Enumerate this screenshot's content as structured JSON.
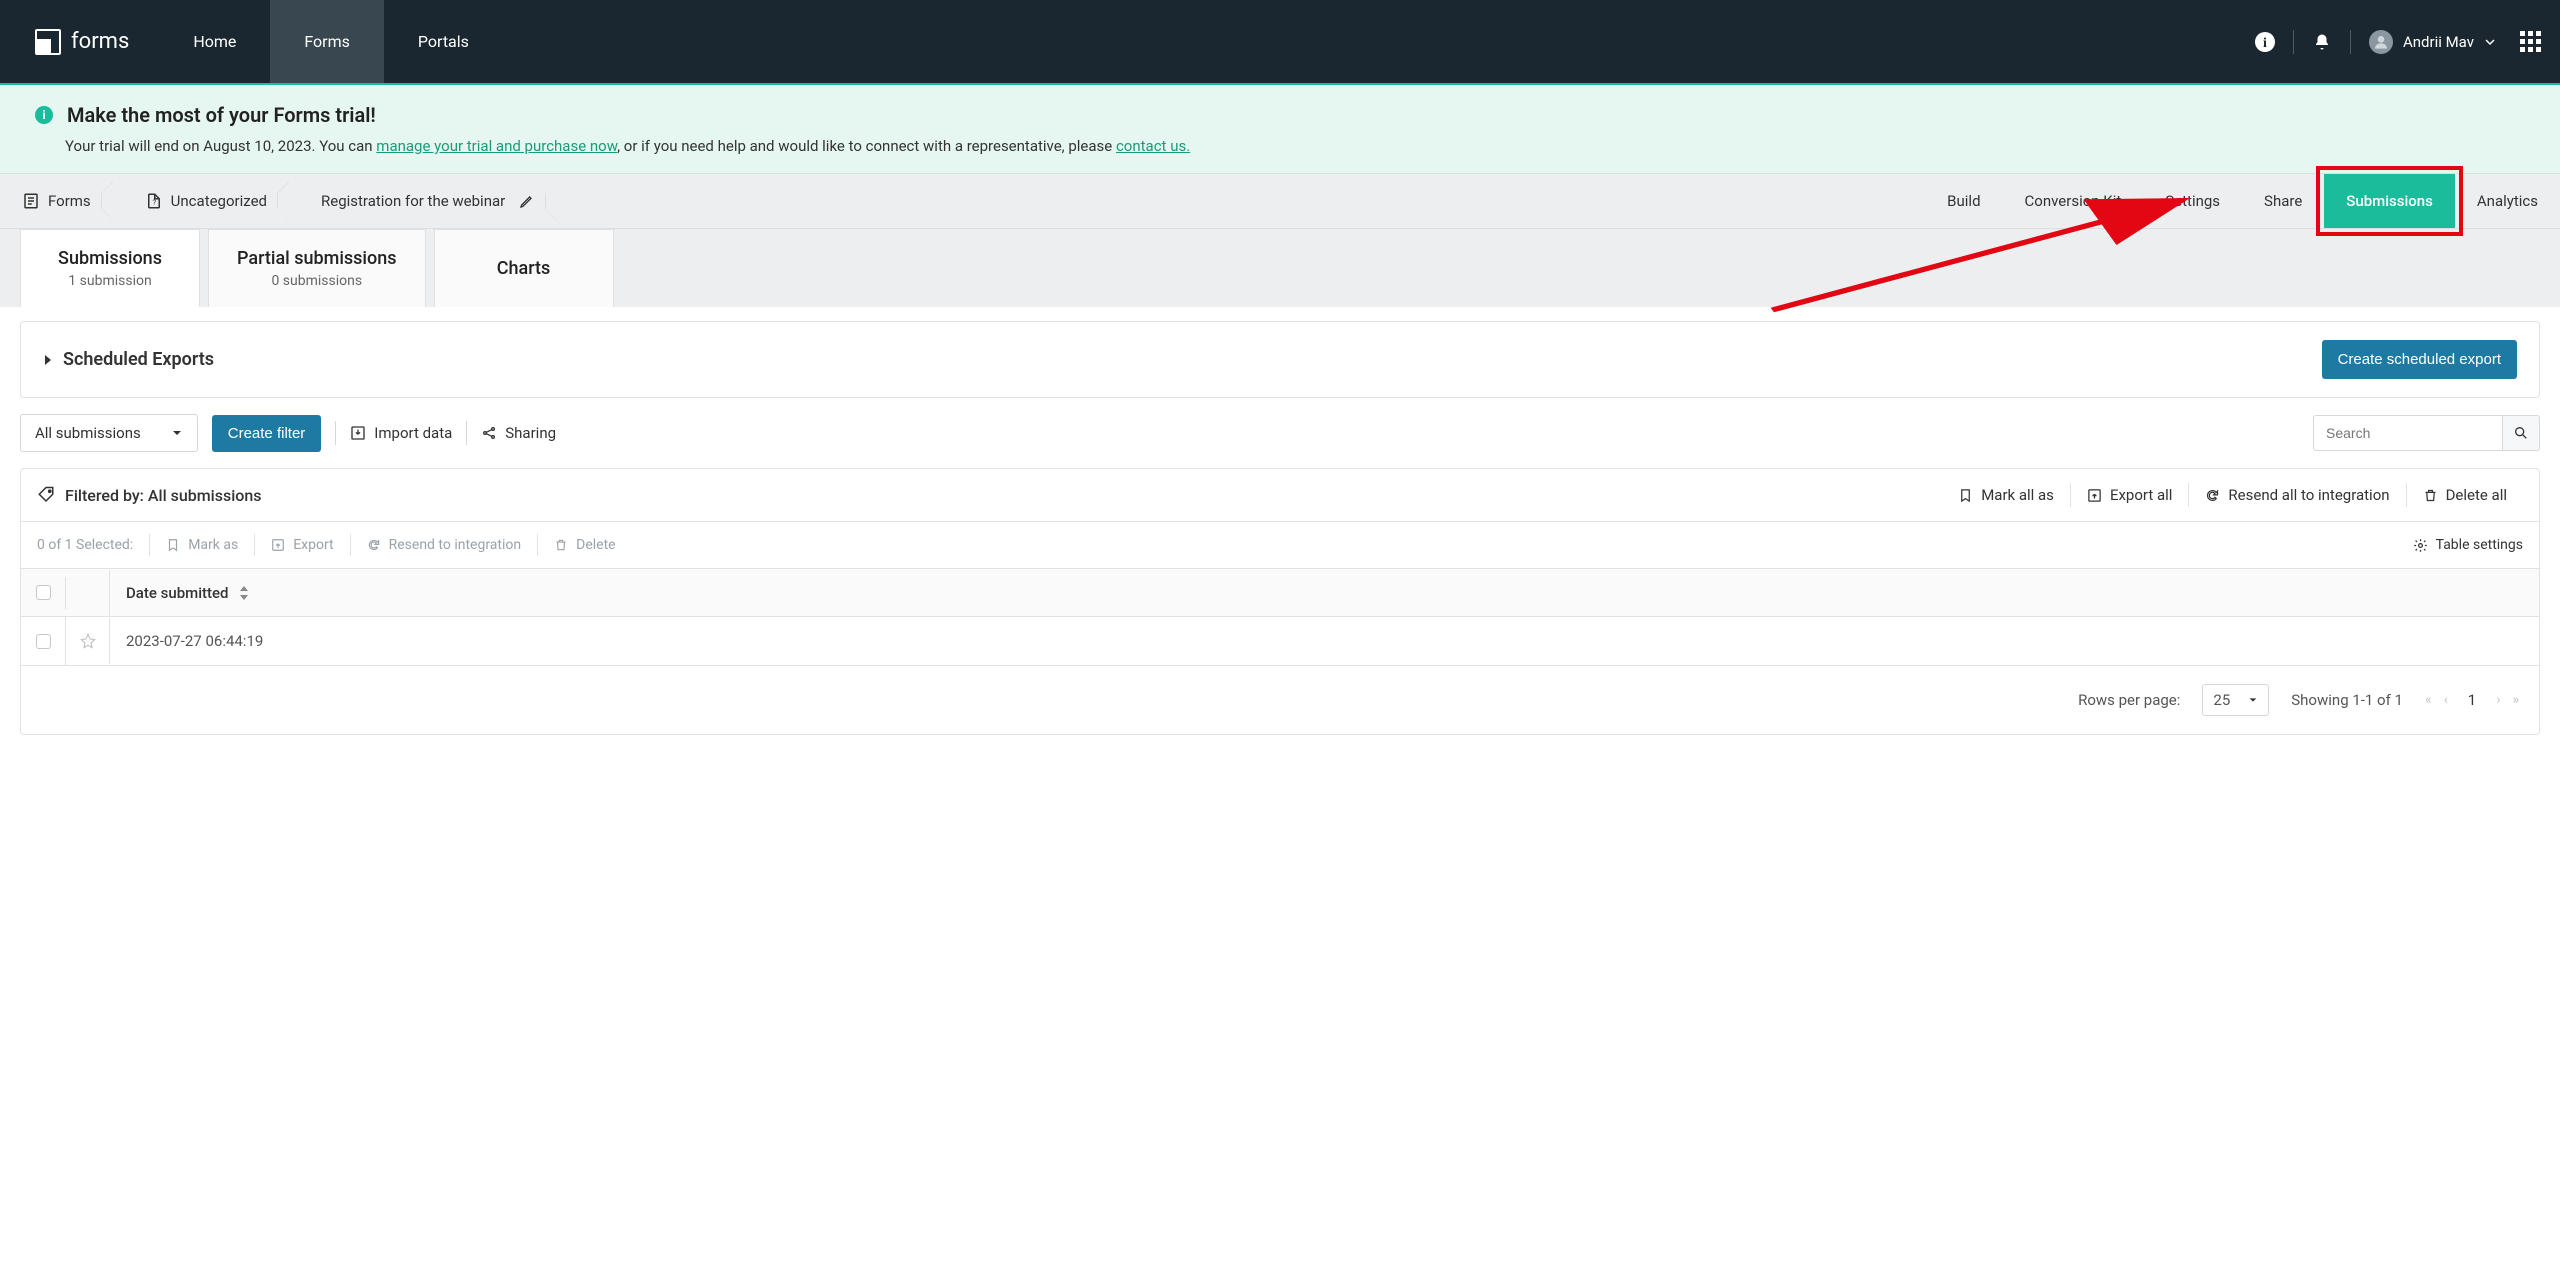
{
  "brand": "forms",
  "nav": {
    "home": "Home",
    "forms": "Forms",
    "portals": "Portals"
  },
  "user": {
    "name": "Andrii Mav"
  },
  "banner": {
    "title": "Make the most of your Forms trial!",
    "prefix": "Your trial will end on August 10, 2023. You can ",
    "link1": "manage your trial and purchase now",
    "middle": ", or if you need help and would like to connect with a representative, please ",
    "link2": "contact us."
  },
  "crumbs": {
    "root": "Forms",
    "folder": "Uncategorized",
    "form": "Registration for the webinar"
  },
  "formnav": {
    "build": "Build",
    "conversion": "Conversion Kit",
    "settings": "Settings",
    "share": "Share",
    "submissions": "Submissions",
    "analytics": "Analytics"
  },
  "subtabs": {
    "submissions": {
      "title": "Submissions",
      "sub": "1 submission"
    },
    "partial": {
      "title": "Partial submissions",
      "sub": "0 submissions"
    },
    "charts": {
      "title": "Charts"
    }
  },
  "scheduled": {
    "title": "Scheduled Exports",
    "button": "Create scheduled export"
  },
  "toolbar": {
    "all": "All submissions",
    "create_filter": "Create filter",
    "import": "Import data",
    "sharing": "Sharing",
    "search_placeholder": "Search"
  },
  "table": {
    "filtered_by": "Filtered by: All submissions",
    "mark_all": "Mark all as",
    "export_all": "Export all",
    "resend_all": "Resend all to integration",
    "delete_all": "Delete all",
    "selected": "0 of 1 Selected:",
    "mark_as": "Mark as",
    "export": "Export",
    "resend": "Resend to integration",
    "delete": "Delete",
    "table_settings": "Table settings",
    "col_date": "Date submitted",
    "rows": [
      {
        "date": "2023-07-27 06:44:19"
      }
    ]
  },
  "pagination": {
    "label": "Rows per page:",
    "per_page": "25",
    "showing": "Showing 1-1 of 1",
    "page": "1"
  }
}
